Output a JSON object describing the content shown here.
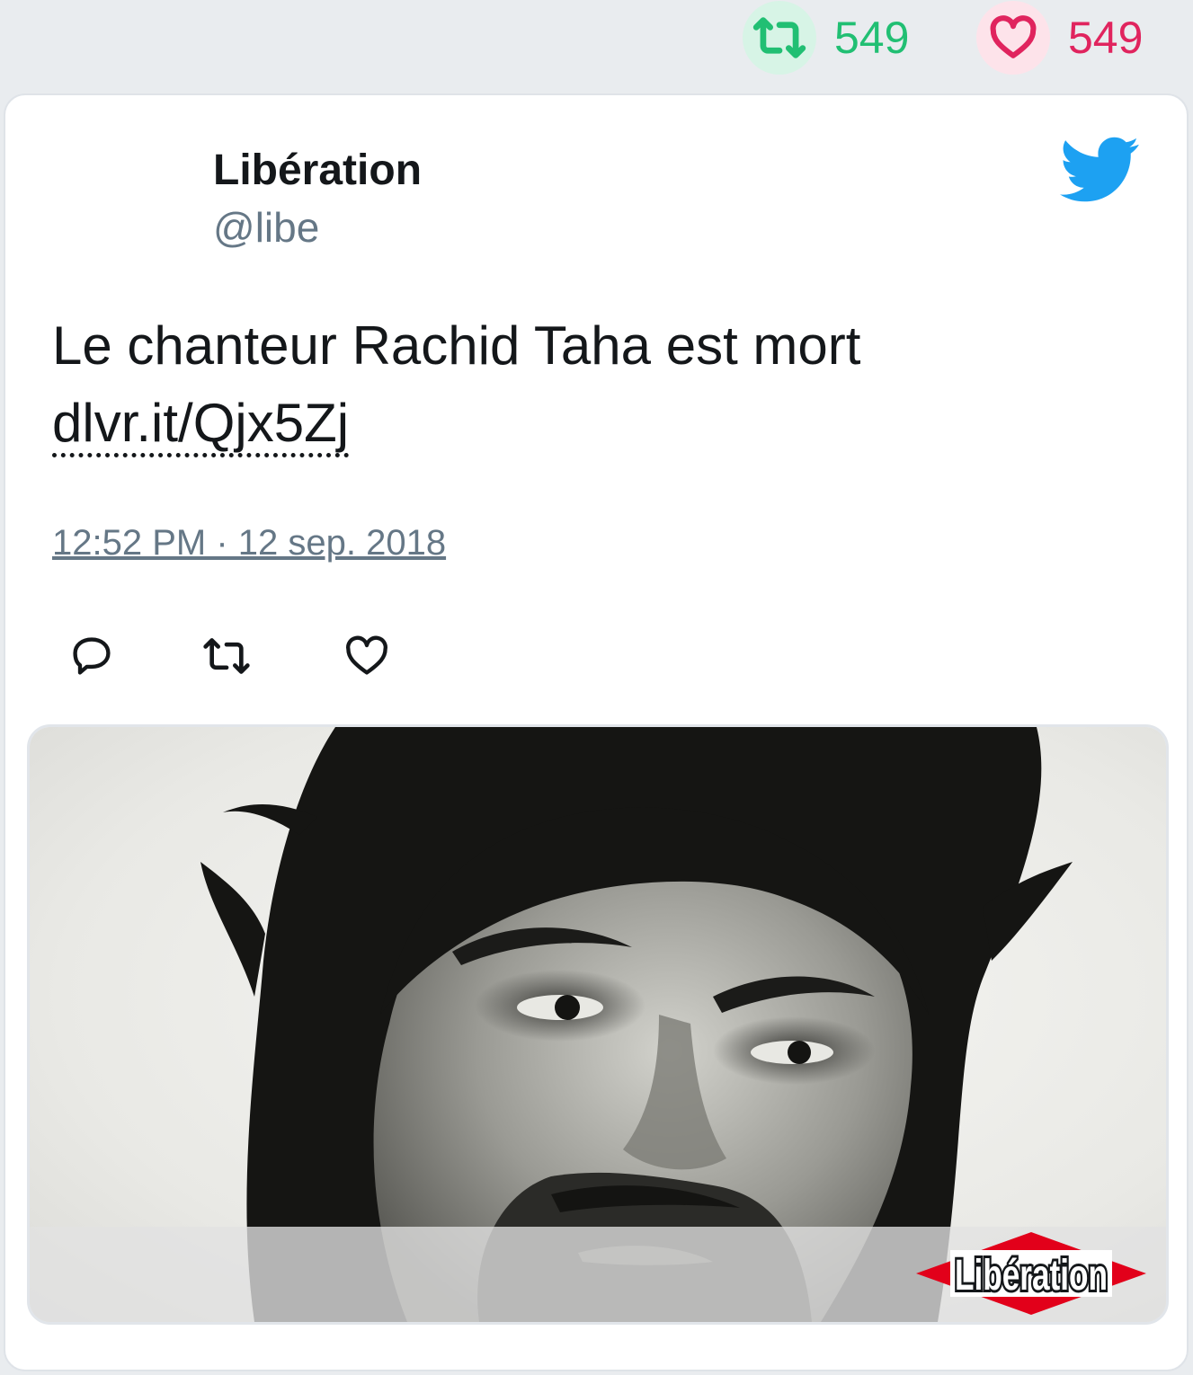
{
  "stats": {
    "retweet_count": "549",
    "like_count": "549",
    "retweet_icon": "retweet-icon",
    "like_icon": "heart-icon"
  },
  "tweet": {
    "author_name": "Libération",
    "author_handle": "@libe",
    "text": "Le chanteur Rachid Taha est mort",
    "link": "dlvr.it/Qjx5Zj",
    "timestamp": "12:52 PM · 12 sep. 2018",
    "platform_icon": "twitter-bird-icon"
  },
  "actions": {
    "reply_icon": "reply-icon",
    "retweet_icon": "retweet-icon",
    "like_icon": "heart-icon"
  },
  "media": {
    "logo_text": "Libération"
  },
  "colors": {
    "background": "#e9ecef",
    "card": "#ffffff",
    "retweet": "#21bf73",
    "like": "#e0245e",
    "twitter_blue": "#1da1f2",
    "secondary_text": "#657786",
    "libe_red": "#e2001a"
  }
}
